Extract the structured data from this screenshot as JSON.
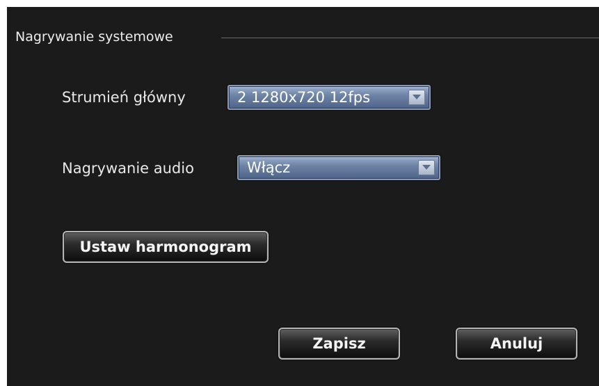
{
  "group": {
    "title": "Nagrywanie systemowe"
  },
  "main_stream": {
    "label": "Strumień główny",
    "value": "2 1280x720 12fps"
  },
  "audio_recording": {
    "label": "Nagrywanie audio",
    "value": "Włącz"
  },
  "buttons": {
    "schedule": "Ustaw harmonogram",
    "save": "Zapisz",
    "cancel": "Anuluj"
  },
  "colors": {
    "background": "#1b1b1b",
    "select_fill": "#6f84a6",
    "button_fill": "#2c2c2c",
    "text": "#e8e8e8"
  },
  "icons": {
    "dropdown": "chevron-down-icon"
  }
}
